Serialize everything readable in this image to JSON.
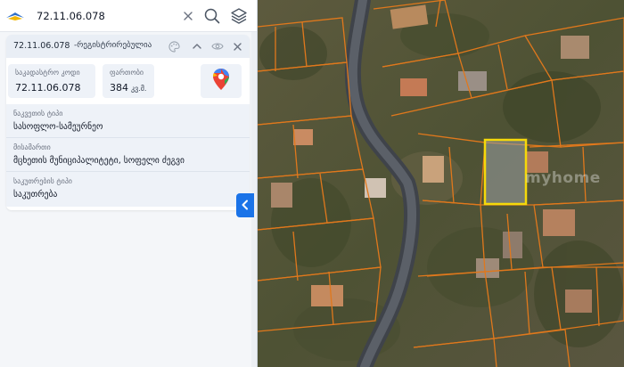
{
  "search": {
    "value": "72.11.06.078"
  },
  "card": {
    "code": "72.11.06.078",
    "status": "-რეგისტრირებულია",
    "cadastral_code": {
      "label": "საკადასტრო კოდი",
      "value": "72.11.06.078"
    },
    "area": {
      "label": "ფართობი",
      "value": "384",
      "unit": "კვ.მ."
    },
    "details": [
      {
        "label": "ნაკვეთის ტიპი",
        "value": "სასოფლო-სამეურნეო"
      },
      {
        "label": "მისამართი",
        "value": "მცხეთის მუნიციპალიტეტი, სოფელი ძეგვი"
      },
      {
        "label": "საკუთრების ტიპი",
        "value": "საკუთრება"
      }
    ]
  },
  "map": {
    "watermark": "myhome"
  },
  "colors": {
    "accent": "#1a73e8",
    "parcel_outline": "#e0781c",
    "selected_parcel": "#f5d90a",
    "road": "#4b5563"
  },
  "icons": [
    "logo-icon",
    "clear-icon",
    "search-icon",
    "layers-icon",
    "palette-icon",
    "chevron-up-icon",
    "eye-icon",
    "close-icon",
    "google-maps-icon",
    "chevron-left-icon"
  ]
}
